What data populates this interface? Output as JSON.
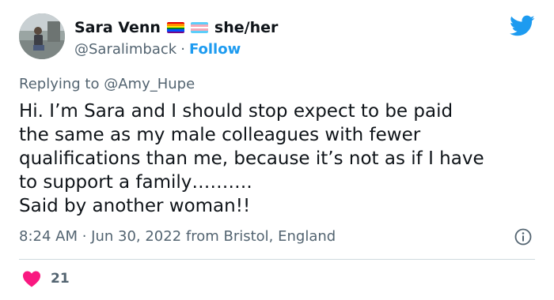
{
  "author": {
    "display_name": "Sara Venn",
    "pronouns": "she/her",
    "handle": "@Saralimback",
    "separator": "·",
    "follow_label": "Follow",
    "flags": [
      "rainbow-pride-flag",
      "transgender-flag"
    ]
  },
  "reply": {
    "prefix": "Replying to",
    "mention": "@Amy_Hupe"
  },
  "tweet": {
    "text": "Hi. I’m Sara and I should stop expect to be paid\nthe same as my male colleagues with fewer\nqualifications than me, because it’s not as if I have\nto support a family……….\nSaid by another woman!!"
  },
  "meta": {
    "timestamp": "8:24 AM · Jun 30, 2022 from Bristol, England"
  },
  "engagement": {
    "likes": "21"
  },
  "colors": {
    "brand_blue": "#1d9bf0",
    "heart_red": "#f91880",
    "text_secondary": "#536471"
  },
  "icons": [
    "twitter-bird-icon",
    "info-icon",
    "heart-icon"
  ]
}
